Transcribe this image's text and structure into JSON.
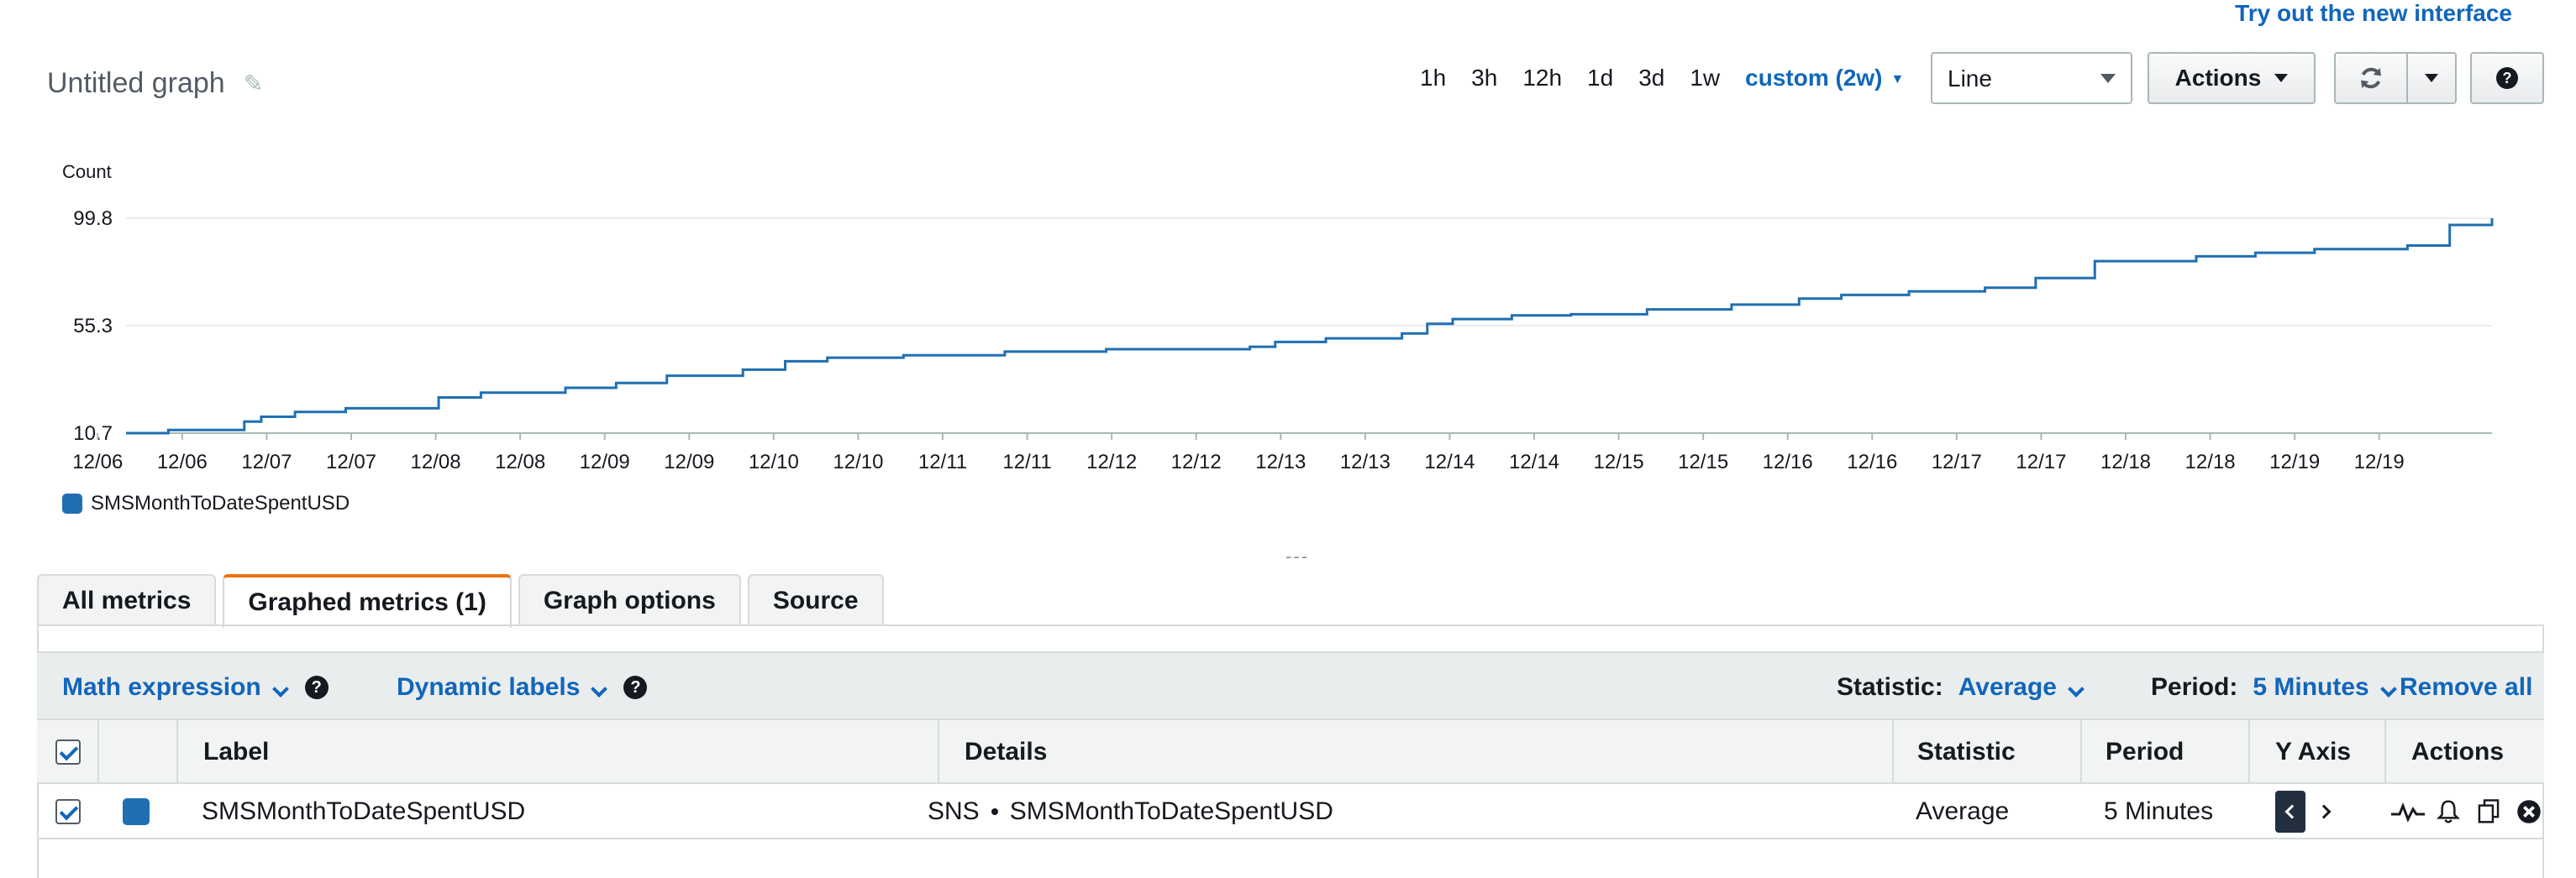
{
  "header": {
    "try_link": "Try out the new interface",
    "title": "Untitled graph"
  },
  "toolbar": {
    "ranges": [
      "1h",
      "3h",
      "12h",
      "1d",
      "3d",
      "1w"
    ],
    "custom_range": "custom (2w)",
    "graph_type": "Line",
    "actions_label": "Actions"
  },
  "icons": {
    "edit": "pencil-icon",
    "refresh": "refresh-icon",
    "help": "help-icon",
    "sparkline": "line-graph-icon",
    "alarm": "bell-icon",
    "copy": "copy-icon",
    "remove": "close-icon"
  },
  "chart_data": {
    "type": "line",
    "ylabel": "Count",
    "ylim": [
      10.7,
      99.8
    ],
    "yticks": [
      "99.8",
      "55.3",
      "10.7"
    ],
    "xticks": [
      "12/06",
      "12/06",
      "12/07",
      "12/07",
      "12/08",
      "12/08",
      "12/09",
      "12/09",
      "12/10",
      "12/10",
      "12/11",
      "12/11",
      "12/12",
      "12/12",
      "12/13",
      "12/13",
      "12/14",
      "12/14",
      "12/15",
      "12/15",
      "12/16",
      "12/16",
      "12/17",
      "12/17",
      "12/18",
      "12/18",
      "12/19",
      "12/19"
    ],
    "grid": true,
    "legend_placement": "bottom-left",
    "color": "#1f6fb2",
    "series": [
      {
        "name": "SMSMonthToDateSpentUSD",
        "x": [
          0,
          0.5,
          1.0,
          1.4,
          1.6,
          2.0,
          2.6,
          3.3,
          3.7,
          4.2,
          5.2,
          5.8,
          6.4,
          7.3,
          7.8,
          8.3,
          9.2,
          10.4,
          11.6,
          12.1,
          13.3,
          13.6,
          14.2,
          15.1,
          15.4,
          15.7,
          16.4,
          17.1,
          18.0,
          19.0,
          19.8,
          20.3,
          21.1,
          22.0,
          22.6,
          23.3,
          24.5,
          25.2,
          25.9,
          27.0,
          27.5,
          28.0
        ],
        "y": [
          10.7,
          12.0,
          12.0,
          15.5,
          17.5,
          19.5,
          21.0,
          21.0,
          25.5,
          27.5,
          29.5,
          31.5,
          34.5,
          37.0,
          40.5,
          42.0,
          43.0,
          44.5,
          45.5,
          45.5,
          46.5,
          48.5,
          50.0,
          52.0,
          56.0,
          58.0,
          59.5,
          60.0,
          62.0,
          64.0,
          66.5,
          68.0,
          69.5,
          71.0,
          75.0,
          82.0,
          84.0,
          85.5,
          87.0,
          88.5,
          97.0,
          99.8
        ]
      }
    ]
  },
  "divider": "---",
  "tabs": [
    {
      "label": "All metrics",
      "active": false
    },
    {
      "label": "Graphed metrics (1)",
      "active": true
    },
    {
      "label": "Graph options",
      "active": false
    },
    {
      "label": "Source",
      "active": false
    }
  ],
  "metrics_bar": {
    "math_expression": "Math expression",
    "dynamic_labels": "Dynamic labels",
    "statistic_label": "Statistic:",
    "statistic_value": "Average",
    "period_label": "Period:",
    "period_value": "5 Minutes",
    "remove_all": "Remove all"
  },
  "table": {
    "columns": [
      "Label",
      "Details",
      "Statistic",
      "Period",
      "Y Axis",
      "Actions"
    ],
    "rows": [
      {
        "label": "SMSMonthToDateSpentUSD",
        "details_namespace": "SNS",
        "details_metric": "SMSMonthToDateSpentUSD",
        "statistic": "Average",
        "period": "5 Minutes",
        "color": "#1f6fb2"
      }
    ]
  }
}
